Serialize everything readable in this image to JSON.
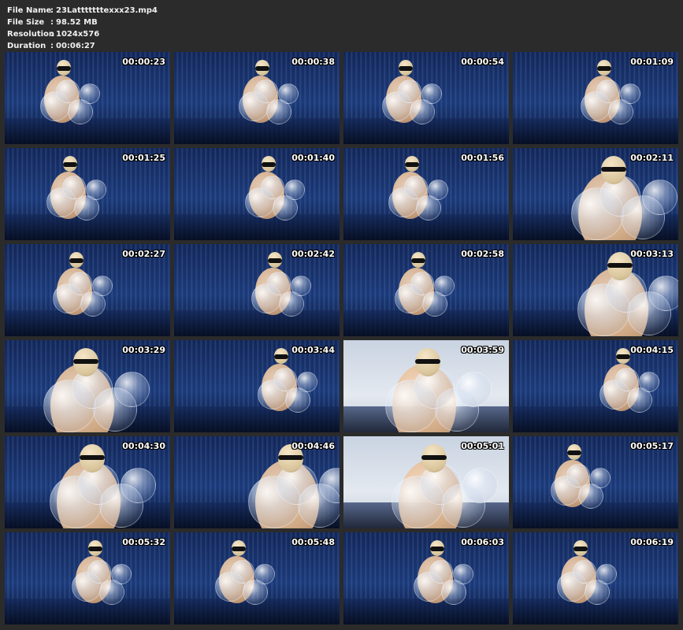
{
  "info": {
    "rows": [
      {
        "label": "File Name",
        "value": "23Latttttttexxx23.mp4"
      },
      {
        "label": "File Size",
        "value": "98.52 MB"
      },
      {
        "label": "Resolution",
        "value": "1024x576"
      },
      {
        "label": "Duration",
        "value": "00:06:27"
      }
    ],
    "separator": ":"
  },
  "thumbnails": [
    {
      "timestamp": "00:00:23"
    },
    {
      "timestamp": "00:00:38"
    },
    {
      "timestamp": "00:00:54"
    },
    {
      "timestamp": "00:01:09"
    },
    {
      "timestamp": "00:01:25"
    },
    {
      "timestamp": "00:01:40"
    },
    {
      "timestamp": "00:01:56"
    },
    {
      "timestamp": "00:02:11"
    },
    {
      "timestamp": "00:02:27"
    },
    {
      "timestamp": "00:02:42"
    },
    {
      "timestamp": "00:02:58"
    },
    {
      "timestamp": "00:03:13"
    },
    {
      "timestamp": "00:03:29"
    },
    {
      "timestamp": "00:03:44"
    },
    {
      "timestamp": "00:03:59"
    },
    {
      "timestamp": "00:04:15"
    },
    {
      "timestamp": "00:04:30"
    },
    {
      "timestamp": "00:04:46"
    },
    {
      "timestamp": "00:05:01"
    },
    {
      "timestamp": "00:05:17"
    },
    {
      "timestamp": "00:05:32"
    },
    {
      "timestamp": "00:05:48"
    },
    {
      "timestamp": "00:06:03"
    },
    {
      "timestamp": "00:06:19"
    }
  ]
}
